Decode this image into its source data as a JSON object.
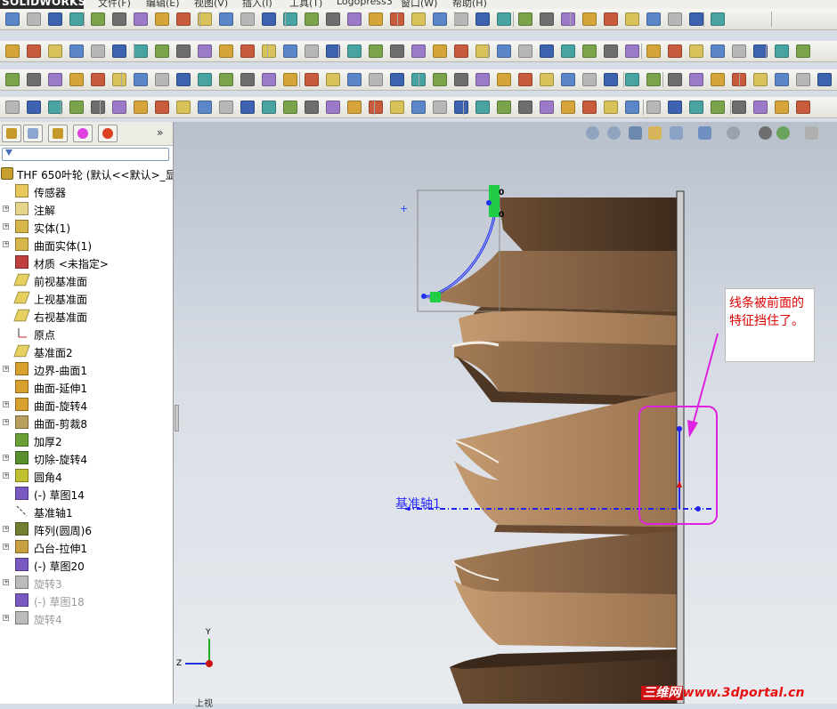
{
  "app": {
    "logo": "SOLIDWORKS"
  },
  "menu": {
    "items": [
      "文件(F)",
      "编辑(E)",
      "视图(V)",
      "插入(I)",
      "工具(T)",
      "Logopress3",
      "窗口(W)",
      "帮助(H)"
    ]
  },
  "feature_tree": {
    "root": "THF 650叶轮  (默认<<默认>_显",
    "items": [
      {
        "label": "传感器",
        "expand": false,
        "icon": "sensor-icon",
        "dim": false
      },
      {
        "label": "注解",
        "expand": true,
        "icon": "annotation-icon",
        "dim": false
      },
      {
        "label": "实体(1)",
        "expand": true,
        "icon": "solid-body-icon",
        "dim": false
      },
      {
        "label": "曲面实体(1)",
        "expand": true,
        "icon": "surface-body-icon",
        "dim": false
      },
      {
        "label": "材质 <未指定>",
        "expand": false,
        "icon": "material-icon",
        "dim": false
      },
      {
        "label": "前视基准面",
        "expand": false,
        "icon": "plane-icon",
        "dim": false
      },
      {
        "label": "上视基准面",
        "expand": false,
        "icon": "plane-icon",
        "dim": false
      },
      {
        "label": "右视基准面",
        "expand": false,
        "icon": "plane-icon",
        "dim": false
      },
      {
        "label": "原点",
        "expand": false,
        "icon": "origin-icon",
        "dim": false
      },
      {
        "label": "基准面2",
        "expand": false,
        "icon": "plane-icon",
        "dim": false
      },
      {
        "label": "边界-曲面1",
        "expand": true,
        "icon": "boundary-surface-icon",
        "dim": false
      },
      {
        "label": "曲面-延伸1",
        "expand": false,
        "icon": "extend-surface-icon",
        "dim": false
      },
      {
        "label": "曲面-旋转4",
        "expand": true,
        "icon": "revolve-surface-icon",
        "dim": false
      },
      {
        "label": "曲面-剪裁8",
        "expand": true,
        "icon": "trim-surface-icon",
        "dim": false
      },
      {
        "label": "加厚2",
        "expand": false,
        "icon": "thicken-icon",
        "dim": false
      },
      {
        "label": "切除-旋转4",
        "expand": true,
        "icon": "cut-revolve-icon",
        "dim": false
      },
      {
        "label": "圆角4",
        "expand": true,
        "icon": "fillet-icon",
        "dim": false
      },
      {
        "label": "(-) 草图14",
        "expand": false,
        "icon": "sketch-icon",
        "dim": false
      },
      {
        "label": "基准轴1",
        "expand": false,
        "icon": "axis-icon",
        "dim": false
      },
      {
        "label": "阵列(圆周)6",
        "expand": true,
        "icon": "circular-pattern-icon",
        "dim": false
      },
      {
        "label": "凸台-拉伸1",
        "expand": true,
        "icon": "boss-extrude-icon",
        "dim": false
      },
      {
        "label": "(-) 草图20",
        "expand": false,
        "icon": "sketch-icon",
        "dim": false
      },
      {
        "label": "旋转3",
        "expand": true,
        "icon": "revolve-icon",
        "dim": true
      },
      {
        "label": "(-) 草图18",
        "expand": false,
        "icon": "sketch-icon",
        "dim": true
      },
      {
        "label": "旋转4",
        "expand": true,
        "icon": "revolve-icon",
        "dim": true
      }
    ]
  },
  "viewport": {
    "callout": "线条被前面的特征挡住了。",
    "axis_label": "基准轴1",
    "triad_y": "Y",
    "triad_z": "Z",
    "bottom_fragment": "上视",
    "highlight_color": "#e020e0",
    "callout_text_color": "#e00000"
  },
  "watermark": {
    "prefix": "三维网",
    "text": "www.3dportal.cn"
  }
}
